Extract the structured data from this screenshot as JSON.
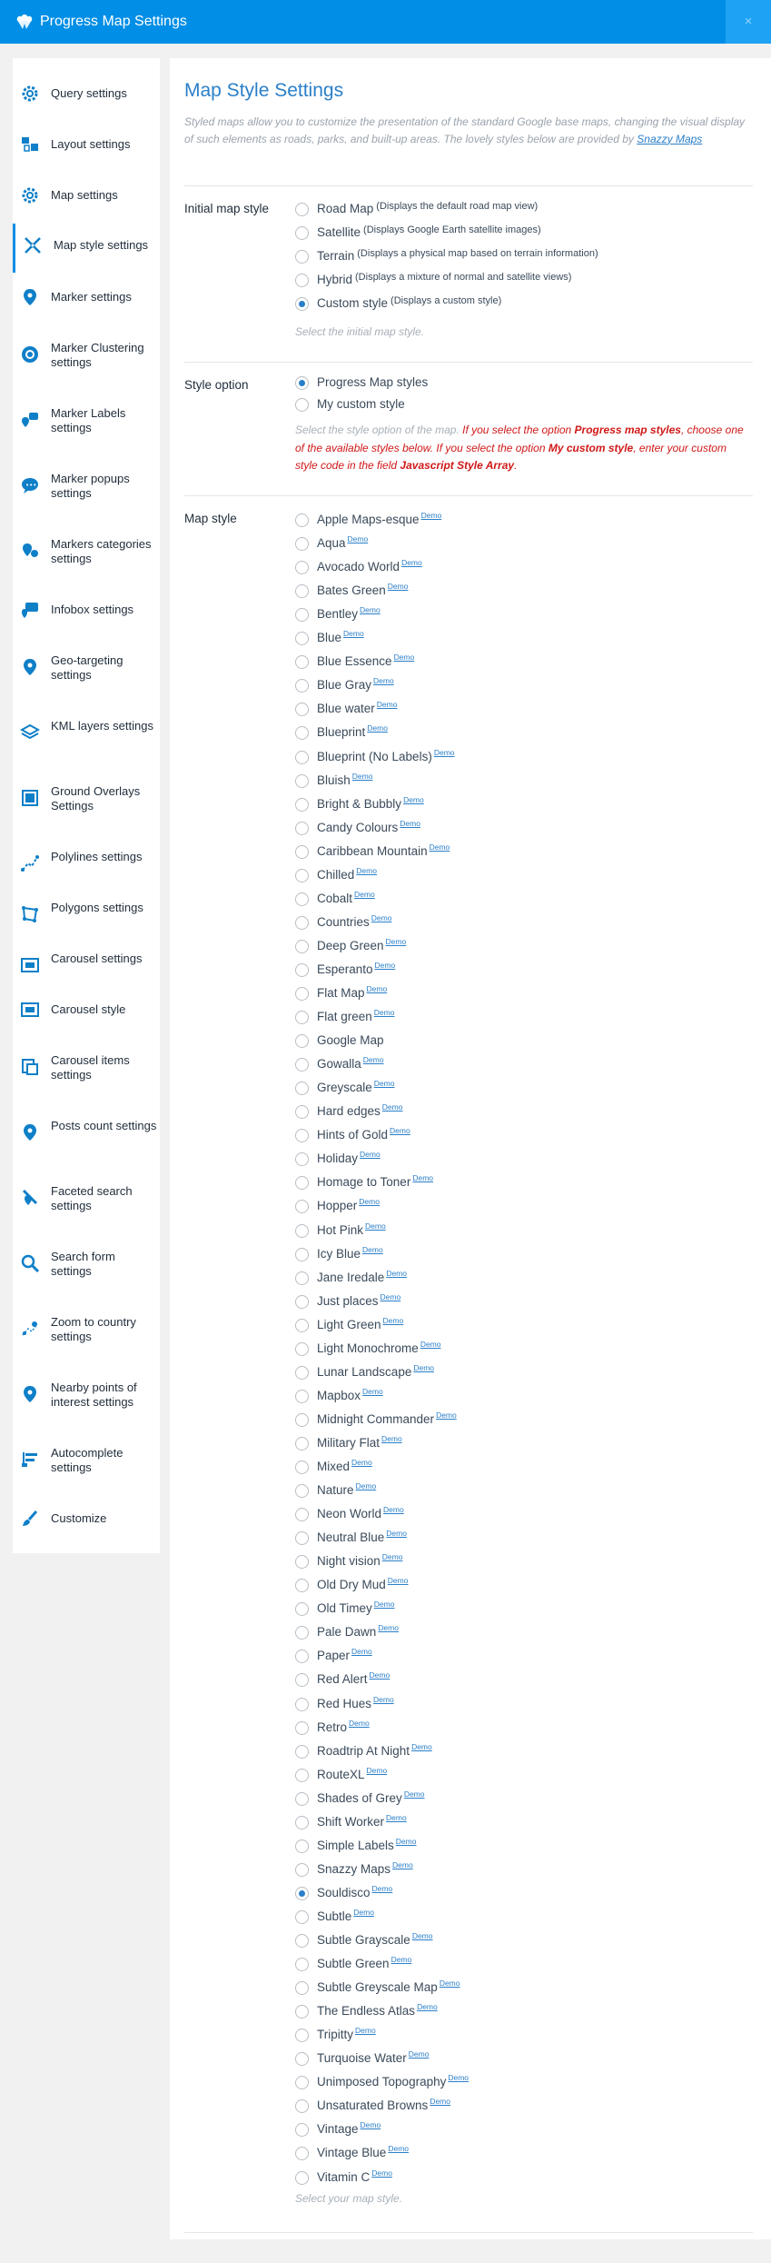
{
  "app": {
    "title": "Progress Map Settings",
    "close_glyph": "×"
  },
  "sidebar": {
    "items": [
      {
        "label": "Query settings",
        "icon": "gear-icon"
      },
      {
        "label": "Layout settings",
        "icon": "layout-icon"
      },
      {
        "label": "Map settings",
        "icon": "map-gear-icon"
      },
      {
        "label": "Map style settings",
        "icon": "map-style-icon",
        "active": true
      },
      {
        "label": "Marker settings",
        "icon": "marker-icon"
      },
      {
        "label": "Marker Clustering settings",
        "icon": "cluster-icon"
      },
      {
        "label": "Marker Labels settings",
        "icon": "marker-labels-icon"
      },
      {
        "label": "Marker popups settings",
        "icon": "popup-icon"
      },
      {
        "label": "Markers categories settings",
        "icon": "categories-icon"
      },
      {
        "label": "Infobox settings",
        "icon": "infobox-icon"
      },
      {
        "label": "Geo-targeting settings",
        "icon": "geo-target-icon"
      },
      {
        "label": "KML layers settings",
        "icon": "layers-icon"
      },
      {
        "label": "Ground Overlays Settings",
        "icon": "overlay-icon"
      },
      {
        "label": "Polylines settings",
        "icon": "polyline-icon"
      },
      {
        "label": "Polygons settings",
        "icon": "polygon-icon"
      },
      {
        "label": "Carousel settings",
        "icon": "carousel-icon"
      },
      {
        "label": "Carousel style",
        "icon": "carousel-style-icon"
      },
      {
        "label": "Carousel items settings",
        "icon": "carousel-items-icon"
      },
      {
        "label": "Posts count settings",
        "icon": "posts-count-icon"
      },
      {
        "label": "Faceted search settings",
        "icon": "faceted-search-icon"
      },
      {
        "label": "Search form settings",
        "icon": "search-icon"
      },
      {
        "label": "Zoom to country settings",
        "icon": "zoom-country-icon"
      },
      {
        "label": "Nearby points of interest settings",
        "icon": "nearby-icon"
      },
      {
        "label": "Autocomplete settings",
        "icon": "autocomplete-icon"
      },
      {
        "label": "Customize",
        "icon": "brush-icon"
      }
    ]
  },
  "main": {
    "title": "Map Style Settings",
    "intro_text": "Styled maps allow you to customize the presentation of the standard Google base maps, changing the visual display of such elements as roads, parks, and built-up areas. The lovely styles below are provided by",
    "intro_link": "Snazzy Maps",
    "initial_map_style": {
      "label": "Initial map style",
      "options": [
        {
          "name": "Road Map",
          "note": "(Displays the default road map view)",
          "selected": false
        },
        {
          "name": "Satellite",
          "note": "(Displays Google Earth satellite images)",
          "selected": false
        },
        {
          "name": "Terrain",
          "note": "(Displays a physical map based on terrain information)",
          "selected": false
        },
        {
          "name": "Hybrid",
          "note": "(Displays a mixture of normal and satellite views)",
          "selected": false
        },
        {
          "name": "Custom style",
          "note": "(Displays a custom style)",
          "selected": true
        }
      ],
      "hint": "Select the initial map style."
    },
    "style_option": {
      "label": "Style option",
      "options": [
        {
          "name": "Progress Map styles",
          "selected": true
        },
        {
          "name": "My custom style",
          "selected": false
        }
      ],
      "desc_1": "Select the style option of the map.",
      "desc_2": "If you select the option",
      "desc_3": "Progress map styles",
      "desc_4": ", choose one of the available styles below. If you select the option",
      "desc_5": "My custom style",
      "desc_6": ", enter your custom style code in the field",
      "desc_7": "Javascript Style Array",
      "desc_8": "."
    },
    "map_style": {
      "label": "Map style",
      "demo_label": "Demo",
      "selected": "Souldisco",
      "options": [
        "Apple Maps-esque",
        "Aqua",
        "Avocado World",
        "Bates Green",
        "Bentley",
        "Blue",
        "Blue Essence",
        "Blue Gray",
        "Blue water",
        "Blueprint",
        "Blueprint (No Labels)",
        "Bluish",
        "Bright & Bubbly",
        "Candy Colours",
        "Caribbean Mountain",
        "Chilled",
        "Cobalt",
        "Countries",
        "Deep Green",
        "Esperanto",
        "Flat Map",
        "Flat green",
        "Google Map",
        "Gowalla",
        "Greyscale",
        "Hard edges",
        "Hints of Gold",
        "Holiday",
        "Homage to Toner",
        "Hopper",
        "Hot Pink",
        "Icy Blue",
        "Jane Iredale",
        "Just places",
        "Light Green",
        "Light Monochrome",
        "Lunar Landscape",
        "Mapbox",
        "Midnight Commander",
        "Military Flat",
        "Mixed",
        "Nature",
        "Neon World",
        "Neutral Blue",
        "Night vision",
        "Old Dry Mud",
        "Old Timey",
        "Pale Dawn",
        "Paper",
        "Red Alert",
        "Red Hues",
        "Retro",
        "Roadtrip At Night",
        "RouteXL",
        "Shades of Grey",
        "Shift Worker",
        "Simple Labels",
        "Snazzy Maps",
        "Souldisco",
        "Subtle",
        "Subtle Grayscale",
        "Subtle Green",
        "Subtle Greyscale Map",
        "The Endless Atlas",
        "Tripitty",
        "Turquoise Water",
        "Unimposed Topography",
        "Unsaturated Browns",
        "Vintage",
        "Vintage Blue",
        "Vitamin C"
      ],
      "no_demo": [
        "Google Map"
      ],
      "hint": "Select your map style."
    }
  },
  "colors": {
    "accent": "#008ee6",
    "link": "#2a7fc9",
    "warning": "#d01818"
  }
}
